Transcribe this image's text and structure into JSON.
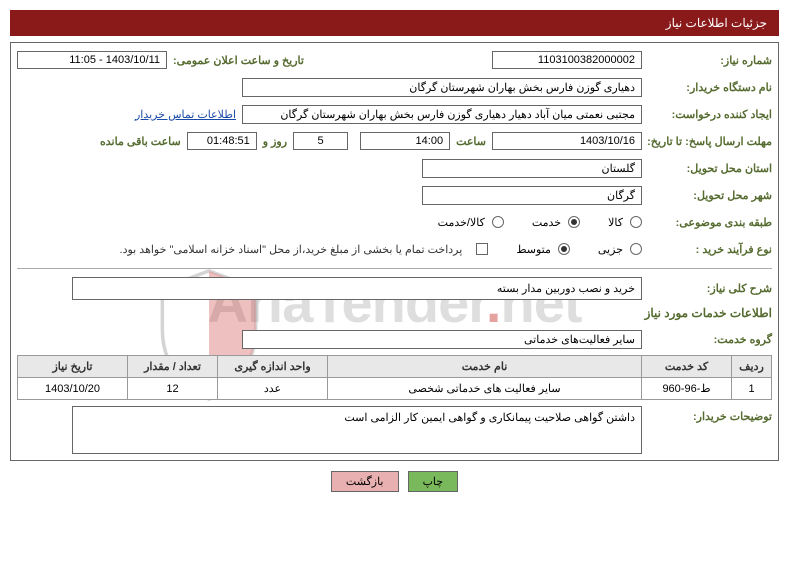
{
  "header": {
    "title": "جزئیات اطلاعات نیاز"
  },
  "req_number": {
    "label": "شماره نیاز:",
    "value": "1103100382000002"
  },
  "announce": {
    "label": "تاریخ و ساعت اعلان عمومی:",
    "value": "1403/10/11 - 11:05"
  },
  "buyer_org": {
    "label": "نام دستگاه خریدار:",
    "value": "دهیاری گوزن فارس بخش بهاران شهرستان گرگان"
  },
  "requester": {
    "label": "ایجاد کننده درخواست:",
    "value": "مجتبی نعمتی میان آباد دهیار دهیاری گوزن فارس بخش بهاران شهرستان گرگان",
    "contact_link": "اطلاعات تماس خریدار"
  },
  "deadline": {
    "label": "مهلت ارسال پاسخ: تا تاریخ:",
    "date": "1403/10/16",
    "time_label": "ساعت",
    "time": "14:00",
    "days": "5",
    "days_label": "روز و",
    "clock": "01:48:51",
    "remaining_label": "ساعت باقی مانده"
  },
  "province": {
    "label": "استان محل تحویل:",
    "value": "گلستان"
  },
  "city": {
    "label": "شهر محل تحویل:",
    "value": "گرگان"
  },
  "subject_class": {
    "label": "طبقه بندی موضوعی:",
    "options": {
      "kala": "کالا",
      "khadmat": "خدمت",
      "kala_khadmat": "کالا/خدمت"
    }
  },
  "process_type": {
    "label": "نوع فرآیند خرید :",
    "options": {
      "jozie": "جزیی",
      "motevaset": "متوسط"
    },
    "note": "پرداخت تمام یا بخشی از مبلغ خرید،از محل \"اسناد خزانه اسلامی\" خواهد بود."
  },
  "overall_desc": {
    "label": "شرح کلی نیاز:",
    "value": "خرید و نصب دوربین مدار بسته"
  },
  "services_section": {
    "title": "اطلاعات خدمات مورد نیاز"
  },
  "service_group": {
    "label": "گروه خدمت:",
    "value": "سایر فعالیت‌های خدماتی"
  },
  "table": {
    "headers": {
      "row": "ردیف",
      "code": "کد خدمت",
      "name": "نام خدمت",
      "unit": "واحد اندازه گیری",
      "qty": "تعداد / مقدار",
      "date": "تاریخ نیاز"
    },
    "rows": [
      {
        "row": "1",
        "code": "ط-96-960",
        "name": "سایر فعالیت های خدماتی شخصی",
        "unit": "عدد",
        "qty": "12",
        "date": "1403/10/20"
      }
    ]
  },
  "buyer_notes": {
    "label": "توضیحات خریدار:",
    "value": "داشتن گواهی صلاحیت پیمانکاری و گواهی ایمین کار الزامی است"
  },
  "buttons": {
    "print": "چاپ",
    "back": "بازگشت"
  },
  "watermark": {
    "part1": "AriaTender",
    "part2": "net"
  }
}
